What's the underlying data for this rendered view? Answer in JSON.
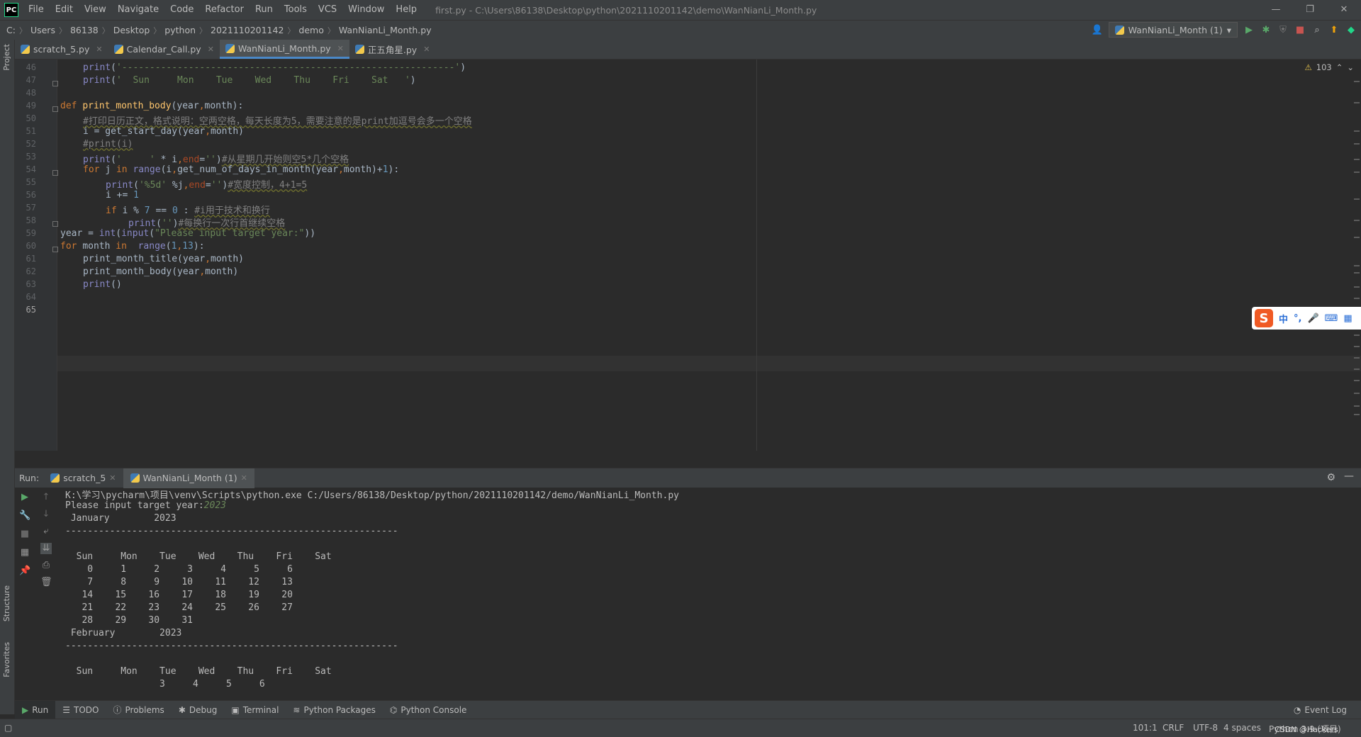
{
  "app": {
    "logo": "PC",
    "window_title": "first.py - C:\\Users\\86138\\Desktop\\python\\2021110201142\\demo\\WanNianLi_Month.py"
  },
  "menu": [
    "File",
    "Edit",
    "View",
    "Navigate",
    "Code",
    "Refactor",
    "Run",
    "Tools",
    "VCS",
    "Window",
    "Help"
  ],
  "window_controls": {
    "minimize": "—",
    "restore": "❐",
    "close": "✕"
  },
  "breadcrumb": [
    "C:",
    "Users",
    "86138",
    "Desktop",
    "python",
    "2021110201142",
    "demo",
    "WanNianLi_Month.py"
  ],
  "run_config": "WanNianLi_Month (1)",
  "left_tool": {
    "project": "Project",
    "structure": "Structure",
    "favorites": "Favorites"
  },
  "tabs": [
    {
      "label": "scratch_5.py"
    },
    {
      "label": "Calendar_Call.py"
    },
    {
      "label": "WanNianLi_Month.py",
      "active": true
    },
    {
      "label": "正五角星.py"
    }
  ],
  "editor": {
    "warnings": "103",
    "line_numbers": [
      "46",
      "47",
      "48",
      "49",
      "50",
      "51",
      "52",
      "53",
      "54",
      "55",
      "56",
      "57",
      "58",
      "59",
      "60",
      "61",
      "62",
      "63",
      "64",
      "65"
    ],
    "current_line": "65"
  },
  "ime": {
    "logo": "S",
    "items": [
      "中",
      "°,",
      "🎤",
      "⌨",
      "▦"
    ]
  },
  "run": {
    "label": "Run:",
    "tabs": [
      {
        "label": "scratch_5"
      },
      {
        "label": "WanNianLi_Month (1)",
        "active": true
      }
    ],
    "output": {
      "cmd": "K:\\学习\\pycharm\\项目\\venv\\Scripts\\python.exe C:/Users/86138/Desktop/python/2021110201142/demo/WanNianLi_Month.py",
      "prompt": "Please input target year:",
      "input": "2023",
      "lines": [
        " January        2023",
        "------------------------------------------------------------",
        "",
        "  Sun     Mon    Tue    Wed    Thu    Fri    Sat",
        "    0     1     2     3     4     5     6",
        "    7     8     9    10    11    12    13",
        "   14    15    16    17    18    19    20",
        "   21    22    23    24    25    26    27",
        "   28    29    30    31",
        " February        2023",
        "------------------------------------------------------------",
        "",
        "  Sun     Mon    Tue    Wed    Thu    Fri    Sat",
        "                 3     4     5     6"
      ]
    }
  },
  "bottom_tools": [
    "Run",
    "TODO",
    "Problems",
    "Debug",
    "Terminal",
    "Python Packages",
    "Python Console"
  ],
  "event_log": "Event Log",
  "status": {
    "position": "101:1",
    "line_sep": "CRLF",
    "encoding": "UTF-8",
    "indent": "4 spaces",
    "interpreter": "Python 3.9 (项目)",
    "watermark": "CSDN @Hackers"
  }
}
